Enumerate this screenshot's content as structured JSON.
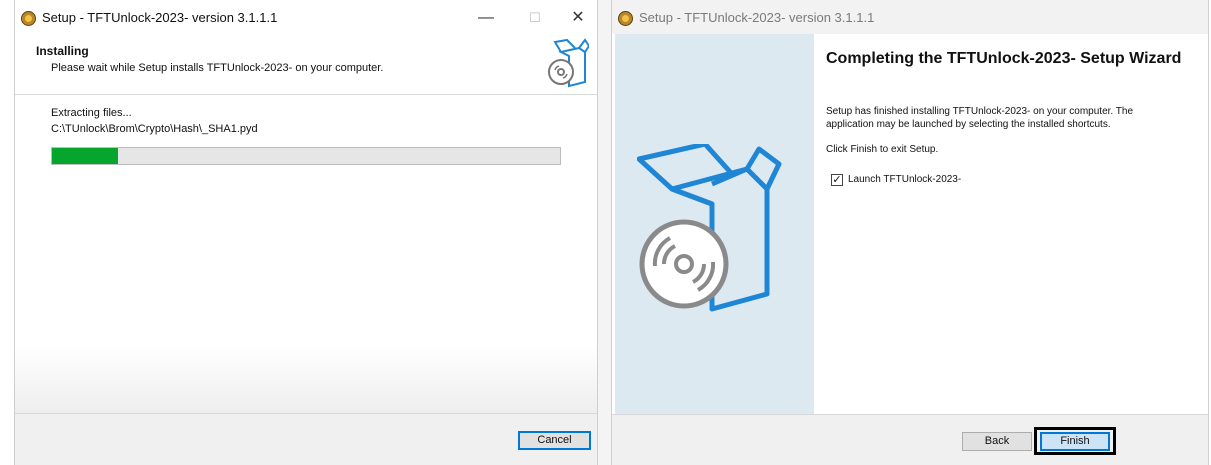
{
  "left_window": {
    "title": "Setup - TFTUnlock-2023- version 3.1.1.1",
    "minimize_glyph": "—",
    "maximize_glyph": "☐",
    "close_glyph": "✕",
    "header": {
      "title": "Installing",
      "subtitle": "Please wait while Setup installs TFTUnlock-2023- on your computer."
    },
    "status_line": "Extracting files...",
    "file_path": "C:\\TUnlock\\Brom\\Crypto\\Hash\\_SHA1.pyd",
    "progress_fraction": 0.13,
    "cancel_label": "Cancel"
  },
  "right_window": {
    "title": "Setup - TFTUnlock-2023- version 3.1.1.1",
    "heading": "Completing the TFTUnlock-2023- Setup Wizard",
    "body_text": "Setup has finished installing TFTUnlock-2023- on your computer. The application may be launched by selecting the installed shortcuts.",
    "click_text": "Click Finish to exit Setup.",
    "launch_checkbox": {
      "label": "Launch TFTUnlock-2023-",
      "checked": true,
      "mark": "✓"
    },
    "back_label": "Back",
    "finish_label": "Finish"
  },
  "colors": {
    "progress": "#06a52e",
    "accent": "#0078d7",
    "side_panel": "#dde9f1",
    "icon_blue": "#1f86d6"
  },
  "icons": [
    "installer-app-icon",
    "box-cd-icon"
  ]
}
